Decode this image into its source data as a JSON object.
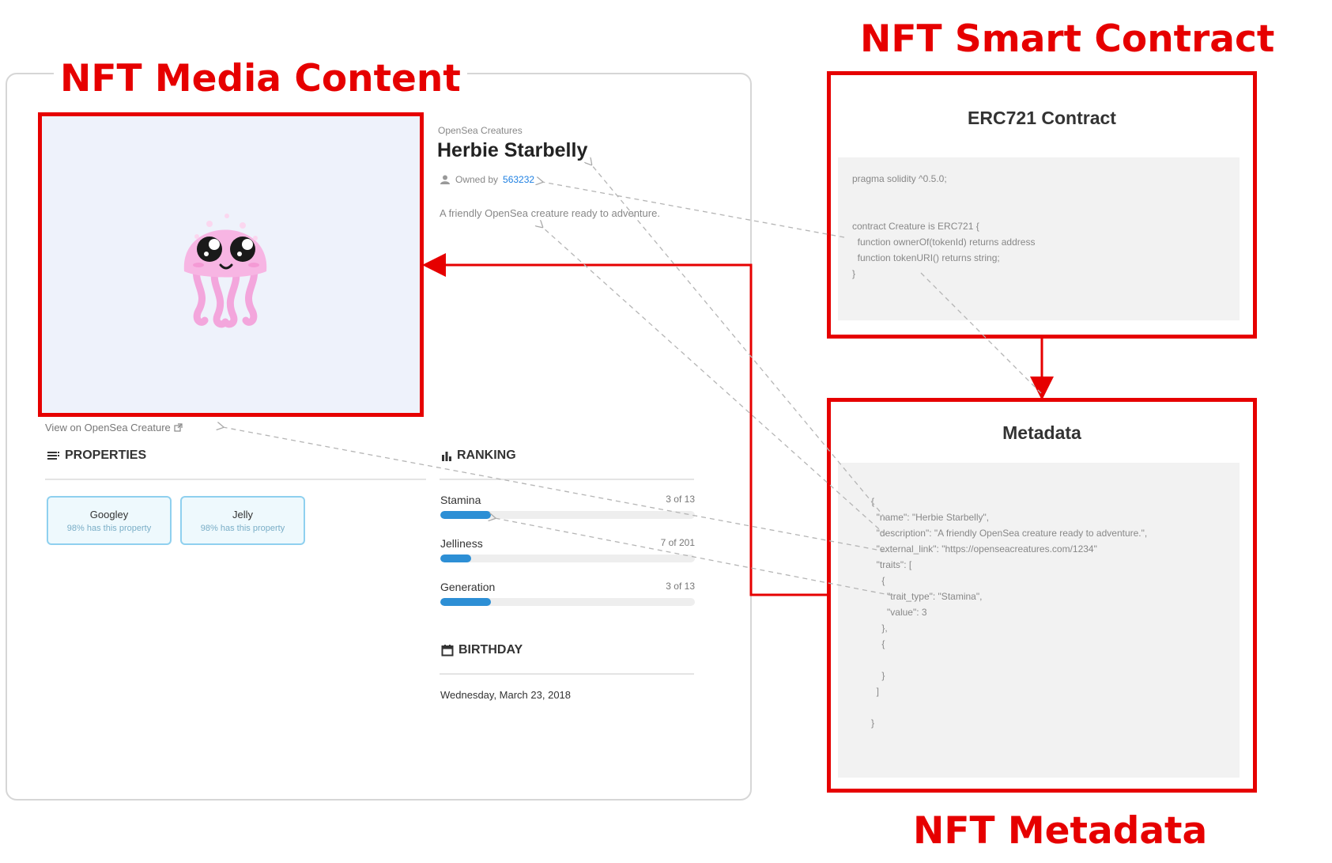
{
  "headings": {
    "media": "NFT Media Content",
    "contract": "NFT Smart Contract",
    "metadata": "NFT Metadata"
  },
  "asset": {
    "collection": "OpenSea Creatures",
    "name": "Herbie Starbelly",
    "owned_prefix": "Owned by",
    "owner": "563232",
    "description": "A friendly OpenSea creature ready to adventure.",
    "view_link": "View on OpenSea Creature"
  },
  "properties": {
    "heading": "PROPERTIES",
    "items": [
      {
        "name": "Googley",
        "rarity": "98% has this property"
      },
      {
        "name": "Jelly",
        "rarity": "98% has this property"
      }
    ]
  },
  "ranking": {
    "heading": "RANKING",
    "items": [
      {
        "label": "Stamina",
        "count": "3 of 13",
        "fraction": 0.2
      },
      {
        "label": "Jelliness",
        "count": "7 of 201",
        "fraction": 0.12
      },
      {
        "label": "Generation",
        "count": "3 of 13",
        "fraction": 0.2
      }
    ]
  },
  "birthday": {
    "heading": "BIRTHDAY",
    "date": "Wednesday, March 23, 2018"
  },
  "contract": {
    "title": "ERC721 Contract",
    "code": [
      "pragma solidity ^0.5.0;",
      "",
      "",
      "contract Creature is ERC721 {",
      "  function ownerOf(tokenId) returns address",
      "  function tokenURI() returns string;",
      "}"
    ]
  },
  "metadata": {
    "title": "Metadata",
    "code": [
      "{",
      "  \"name\": \"Herbie Starbelly\",",
      "  \"description\": \"A friendly OpenSea creature ready to adventure.\",",
      "  \"external_link\": \"https://openseacreatures.com/1234\"",
      "  \"traits\": [",
      "    {",
      "      \"trait_type\": \"Stamina\",",
      "      \"value\": 3",
      "    },",
      "    {",
      "",
      "    }",
      "  ]",
      "",
      "}"
    ]
  },
  "colors": {
    "accent_red": "#e60000",
    "link_blue": "#2081e2",
    "bar_blue": "#2d8fd5",
    "media_bg": "#eef2fb"
  },
  "icons": [
    "person-icon",
    "external-link-icon",
    "list-icon",
    "bar-chart-icon",
    "calendar-icon",
    "jellyfish-image"
  ]
}
